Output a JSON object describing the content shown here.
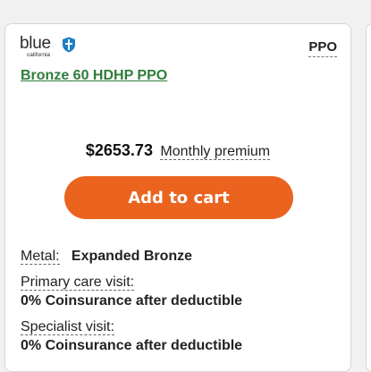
{
  "colors": {
    "accent_button": "#ea6420",
    "plan_name": "#2f7d3a",
    "logo_shield": "#1b7fc7"
  },
  "card": {
    "logo": {
      "word": "blue",
      "sub": "california",
      "icon": "shield-icon"
    },
    "plan_type": "PPO",
    "plan_name": "Bronze 60 HDHP PPO",
    "price": "$2653.73",
    "price_label": "Monthly premium",
    "add_to_cart": "Add to cart",
    "details": {
      "metal_label": "Metal:",
      "metal_value": "Expanded Bronze",
      "primary_care_label": "Primary care visit:",
      "primary_care_value": "0% Coinsurance after deductible",
      "specialist_label": "Specialist visit:",
      "specialist_value": "0% Coinsurance after deductible"
    }
  }
}
